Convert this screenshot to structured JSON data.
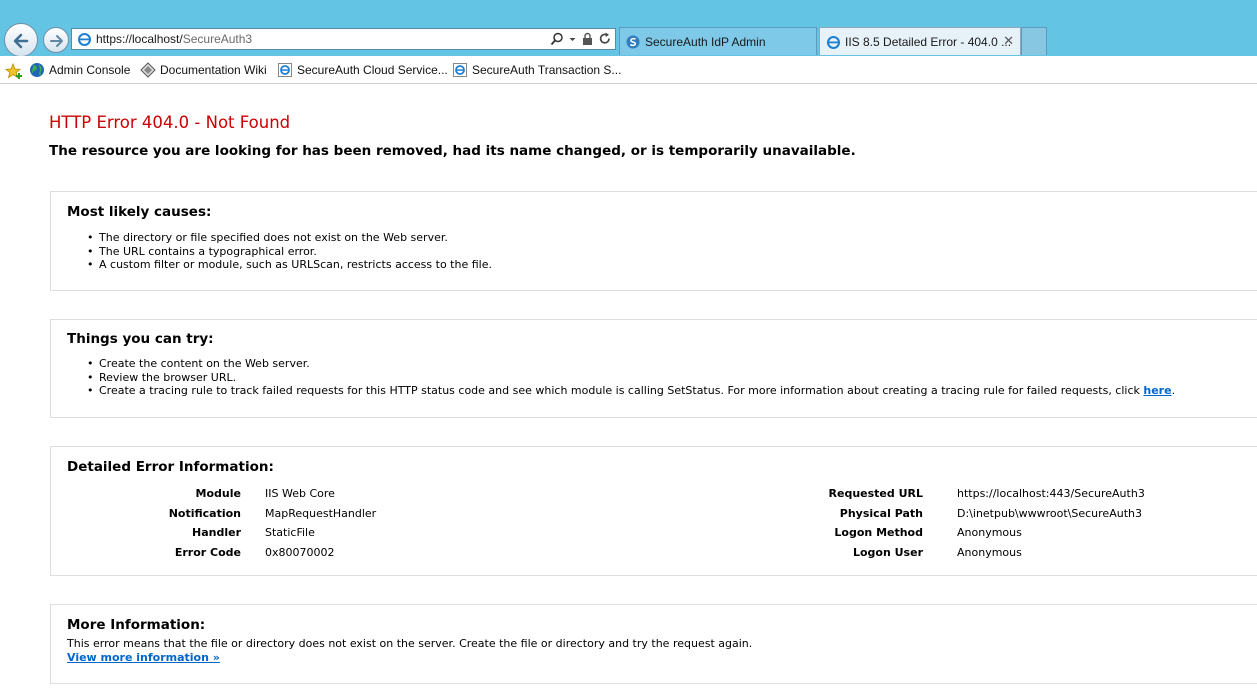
{
  "browser": {
    "address": {
      "host": "https://localhost/",
      "path": "SecureAuth3"
    },
    "tabs": [
      {
        "label": "SecureAuth IdP Admin"
      },
      {
        "label": "IIS 8.5 Detailed Error - 404.0 ...",
        "close": "✕"
      }
    ],
    "favorites": [
      {
        "label": "Admin Console",
        "icon": "globe-icon"
      },
      {
        "label": "Documentation Wiki",
        "icon": "diamond-icon"
      },
      {
        "label": "SecureAuth Cloud Service...",
        "icon": "ie-page-icon"
      },
      {
        "label": "SecureAuth Transaction S...",
        "icon": "ie-page-icon"
      }
    ]
  },
  "page": {
    "title": "HTTP Error 404.0 - Not Found",
    "subtitle": "The resource you are looking for has been removed, had its name changed, or is temporarily unavailable.",
    "causes": {
      "heading": "Most likely causes:",
      "items": [
        "The directory or file specified does not exist on the Web server.",
        "The URL contains a typographical error.",
        "A custom filter or module, such as URLScan, restricts access to the file."
      ]
    },
    "try": {
      "heading": "Things you can try:",
      "items": [
        "Create the content on the Web server.",
        "Review the browser URL."
      ],
      "tracing_text": "Create a tracing rule to track failed requests for this HTTP status code and see which module is calling SetStatus. For more information about creating a tracing rule for failed requests, click ",
      "tracing_link": "here",
      "tracing_end": "."
    },
    "details": {
      "heading": "Detailed Error Information:",
      "left": [
        {
          "key": "Module",
          "value": "IIS Web Core"
        },
        {
          "key": "Notification",
          "value": "MapRequestHandler"
        },
        {
          "key": "Handler",
          "value": "StaticFile"
        },
        {
          "key": "Error Code",
          "value": "0x80070002"
        }
      ],
      "right": [
        {
          "key": "Requested URL",
          "value": "https://localhost:443/SecureAuth3"
        },
        {
          "key": "Physical Path",
          "value": "D:\\inetpub\\wwwroot\\SecureAuth3"
        },
        {
          "key": "Logon Method",
          "value": "Anonymous"
        },
        {
          "key": "Logon User",
          "value": "Anonymous"
        }
      ]
    },
    "more": {
      "heading": "More Information:",
      "text": "This error means that the file or directory does not exist on the server. Create the file or directory and try the request again.",
      "link": "View more information »"
    }
  },
  "colors": {
    "chrome": "#63c4e4",
    "error_title": "#cc0000",
    "link": "#0066cc"
  }
}
